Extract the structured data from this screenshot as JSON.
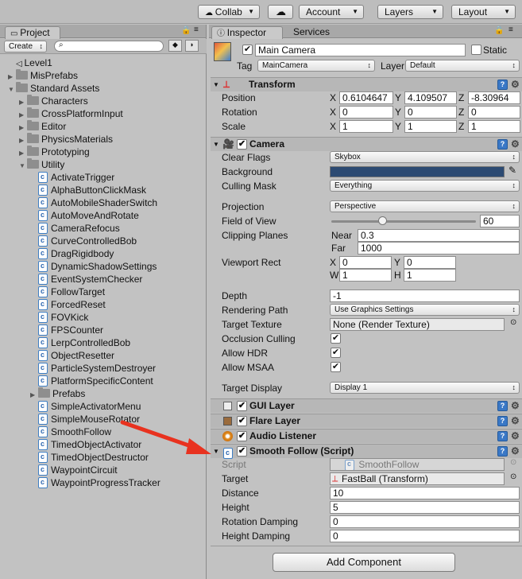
{
  "toolbar": {
    "collab": "Collab",
    "account": "Account",
    "layers": "Layers",
    "layout": "Layout"
  },
  "project": {
    "tab": "Project",
    "create": "Create",
    "search_placeholder": "",
    "tree": [
      {
        "label": "Level1",
        "type": "unity",
        "indent": 0,
        "arrow": ""
      },
      {
        "label": "MisPrefabs",
        "type": "folder",
        "indent": 0,
        "arrow": "▶"
      },
      {
        "label": "Standard Assets",
        "type": "folder",
        "indent": 0,
        "arrow": "▼"
      },
      {
        "label": "Characters",
        "type": "folder",
        "indent": 1,
        "arrow": "▶"
      },
      {
        "label": "CrossPlatformInput",
        "type": "folder",
        "indent": 1,
        "arrow": "▶"
      },
      {
        "label": "Editor",
        "type": "folder",
        "indent": 1,
        "arrow": "▶"
      },
      {
        "label": "PhysicsMaterials",
        "type": "folder",
        "indent": 1,
        "arrow": "▶"
      },
      {
        "label": "Prototyping",
        "type": "folder",
        "indent": 1,
        "arrow": "▶"
      },
      {
        "label": "Utility",
        "type": "folder",
        "indent": 1,
        "arrow": "▼"
      },
      {
        "label": "ActivateTrigger",
        "type": "script",
        "indent": 2,
        "arrow": ""
      },
      {
        "label": "AlphaButtonClickMask",
        "type": "script",
        "indent": 2,
        "arrow": ""
      },
      {
        "label": "AutoMobileShaderSwitch",
        "type": "script",
        "indent": 2,
        "arrow": ""
      },
      {
        "label": "AutoMoveAndRotate",
        "type": "script",
        "indent": 2,
        "arrow": ""
      },
      {
        "label": "CameraRefocus",
        "type": "script",
        "indent": 2,
        "arrow": ""
      },
      {
        "label": "CurveControlledBob",
        "type": "script",
        "indent": 2,
        "arrow": ""
      },
      {
        "label": "DragRigidbody",
        "type": "script",
        "indent": 2,
        "arrow": ""
      },
      {
        "label": "DynamicShadowSettings",
        "type": "script",
        "indent": 2,
        "arrow": ""
      },
      {
        "label": "EventSystemChecker",
        "type": "script",
        "indent": 2,
        "arrow": ""
      },
      {
        "label": "FollowTarget",
        "type": "script",
        "indent": 2,
        "arrow": ""
      },
      {
        "label": "ForcedReset",
        "type": "script",
        "indent": 2,
        "arrow": ""
      },
      {
        "label": "FOVKick",
        "type": "script",
        "indent": 2,
        "arrow": ""
      },
      {
        "label": "FPSCounter",
        "type": "script",
        "indent": 2,
        "arrow": ""
      },
      {
        "label": "LerpControlledBob",
        "type": "script",
        "indent": 2,
        "arrow": ""
      },
      {
        "label": "ObjectResetter",
        "type": "script",
        "indent": 2,
        "arrow": ""
      },
      {
        "label": "ParticleSystemDestroyer",
        "type": "script",
        "indent": 2,
        "arrow": ""
      },
      {
        "label": "PlatformSpecificContent",
        "type": "script",
        "indent": 2,
        "arrow": ""
      },
      {
        "label": "Prefabs",
        "type": "folder",
        "indent": 2,
        "arrow": "▶"
      },
      {
        "label": "SimpleActivatorMenu",
        "type": "script",
        "indent": 2,
        "arrow": ""
      },
      {
        "label": "SimpleMouseRotator",
        "type": "script",
        "indent": 2,
        "arrow": ""
      },
      {
        "label": "SmoothFollow",
        "type": "script",
        "indent": 2,
        "arrow": ""
      },
      {
        "label": "TimedObjectActivator",
        "type": "script",
        "indent": 2,
        "arrow": ""
      },
      {
        "label": "TimedObjectDestructor",
        "type": "script",
        "indent": 2,
        "arrow": ""
      },
      {
        "label": "WaypointCircuit",
        "type": "script",
        "indent": 2,
        "arrow": ""
      },
      {
        "label": "WaypointProgressTracker",
        "type": "script",
        "indent": 2,
        "arrow": ""
      }
    ]
  },
  "inspector": {
    "tab": "Inspector",
    "services_tab": "Services",
    "object_name": "Main Camera",
    "static_label": "Static",
    "tag_label": "Tag",
    "tag_value": "MainCamera",
    "layer_label": "Layer",
    "layer_value": "Default",
    "transform": {
      "title": "Transform",
      "position_label": "Position",
      "rotation_label": "Rotation",
      "scale_label": "Scale",
      "x": "X",
      "y": "Y",
      "z": "Z",
      "position": [
        "0.6104647",
        "4.109507",
        "-8.30964"
      ],
      "rotation": [
        "0",
        "0",
        "0"
      ],
      "scale": [
        "1",
        "1",
        "1"
      ]
    },
    "camera": {
      "title": "Camera",
      "clear_flags_label": "Clear Flags",
      "clear_flags": "Skybox",
      "background_label": "Background",
      "culling_mask_label": "Culling Mask",
      "culling_mask": "Everything",
      "projection_label": "Projection",
      "projection": "Perspective",
      "fov_label": "Field of View",
      "fov": "60",
      "fov_fraction": 0.35,
      "clipping_label": "Clipping Planes",
      "near_label": "Near",
      "near": "0.3",
      "far_label": "Far",
      "far": "1000",
      "viewport_label": "Viewport Rect",
      "vx": "0",
      "vy": "0",
      "vw": "1",
      "vh": "1",
      "x": "X",
      "y": "Y",
      "w": "W",
      "h": "H",
      "depth_label": "Depth",
      "depth": "-1",
      "rendering_path_label": "Rendering Path",
      "rendering_path": "Use Graphics Settings",
      "target_texture_label": "Target Texture",
      "target_texture": "None (Render Texture)",
      "occlusion_label": "Occlusion Culling",
      "hdr_label": "Allow HDR",
      "msaa_label": "Allow MSAA",
      "target_display_label": "Target Display",
      "target_display": "Display 1"
    },
    "gui_layer": "GUI Layer",
    "flare_layer": "Flare Layer",
    "audio_listener": "Audio Listener",
    "smooth_follow": {
      "title": "Smooth Follow (Script)",
      "script_label": "Script",
      "script": "SmoothFollow",
      "target_label": "Target",
      "target": "FastBall (Transform)",
      "distance_label": "Distance",
      "distance": "10",
      "height_label": "Height",
      "height": "5",
      "rotation_damping_label": "Rotation Damping",
      "rotation_damping": "0",
      "height_damping_label": "Height Damping",
      "height_damping": "0"
    },
    "add_component": "Add Component"
  },
  "colors": {
    "background_swatch": "#2c4a72",
    "arrow": "#e8321f",
    "help": "#3a78c6"
  }
}
